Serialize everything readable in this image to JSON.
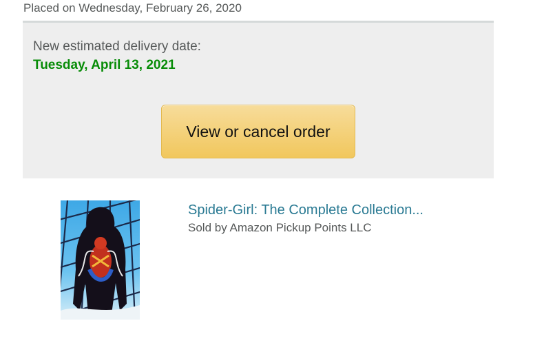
{
  "order": {
    "placed_text": "Placed on Wednesday, February 26, 2020"
  },
  "delivery": {
    "heading": "New estimated delivery date:",
    "date": "Tuesday, April 13, 2021",
    "date_color": "#078c07"
  },
  "actions": {
    "cancel_label": "View or cancel order",
    "button_color": "#f1c75d"
  },
  "item": {
    "title": "Spider-Girl: The Complete Collection...",
    "seller": "Sold by Amazon Pickup Points LLC",
    "thumbnail_icon": "comic-cover-image",
    "link_color": "#2a7a93"
  }
}
